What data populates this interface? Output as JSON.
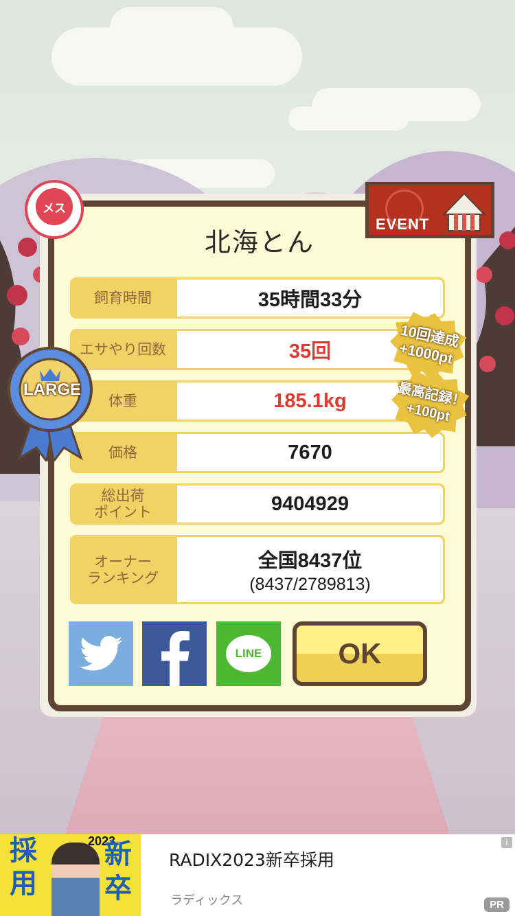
{
  "dialog": {
    "title": "北海とん",
    "rows": [
      {
        "label": "飼育時間",
        "value": "35時間33分"
      },
      {
        "label": "エサやり回数",
        "value": "35回"
      },
      {
        "label": "体重",
        "value": "185.1kg"
      },
      {
        "label": "価格",
        "value": "7670"
      },
      {
        "label": "総出荷\nポイント",
        "value": "9404929"
      },
      {
        "label": "オーナー\nランキング",
        "value": "全国8437位",
        "sub": "(8437/2789813)"
      }
    ],
    "ok_label": "OK"
  },
  "badges": {
    "gender": "メス",
    "event": "EVENT",
    "size": "LARGE",
    "bonus1_line1": "10回達成",
    "bonus1_line2": "+1000pt",
    "bonus2_line1": "最高記録！",
    "bonus2_line2": "+100pt"
  },
  "share": {
    "twitter": "twitter-icon",
    "facebook": "facebook-icon",
    "line": "LINE"
  },
  "ad": {
    "title": "RADIX2023新卒採用",
    "advertiser": "ラディックス",
    "info": "i",
    "pr": "PR",
    "banner_left": "採用",
    "banner_right": "新卒",
    "banner_year": "2023"
  },
  "colors": {
    "frame": "#5e4433",
    "panel": "#fdfbd6",
    "label_bg": "#f1d265",
    "highlight": "#e03a2e",
    "twitter": "#7baede",
    "facebook": "#3b5998",
    "line": "#4cb831"
  }
}
